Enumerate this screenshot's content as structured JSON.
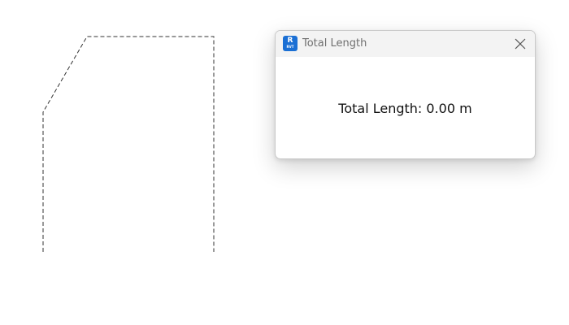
{
  "window": {
    "title": "Total Length",
    "app_icon": {
      "name": "revit-app-icon",
      "glyph": "R",
      "subtext": "RVT",
      "color": "#1a6fd4"
    },
    "close_icon": "close-icon"
  },
  "content": {
    "total_length_text": "Total Length: 0.00 m"
  },
  "colors": {
    "background": "#ffffff",
    "titlebar": "#f3f3f3",
    "title_text": "#6f6f6f",
    "sketch_line": "#333333"
  }
}
